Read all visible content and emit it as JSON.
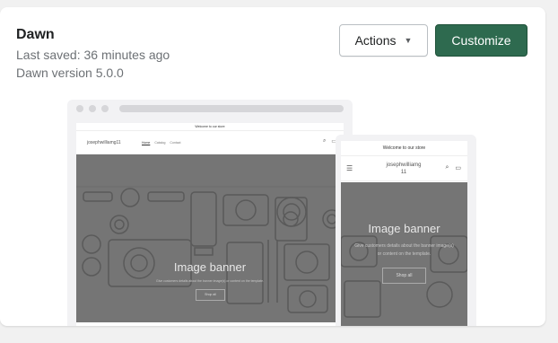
{
  "theme": {
    "name": "Dawn",
    "last_saved": "Last saved: 36 minutes ago",
    "version": "Dawn version 5.0.0"
  },
  "buttons": {
    "actions_label": "Actions",
    "customize_label": "Customize"
  },
  "colors": {
    "primary": "#2e6a4f",
    "banner_bg": "#757575"
  },
  "preview": {
    "announcement": "Welcome to our store",
    "store_name_desktop": "josephwilliamg11",
    "store_name_mobile": "josephwilliamg\n11",
    "nav": [
      "Home",
      "Catalog",
      "Contact"
    ],
    "banner_title": "Image banner",
    "banner_subtitle": "Give customers details about the banner image(s) or content on the template.",
    "shop_button": "Shop all"
  }
}
